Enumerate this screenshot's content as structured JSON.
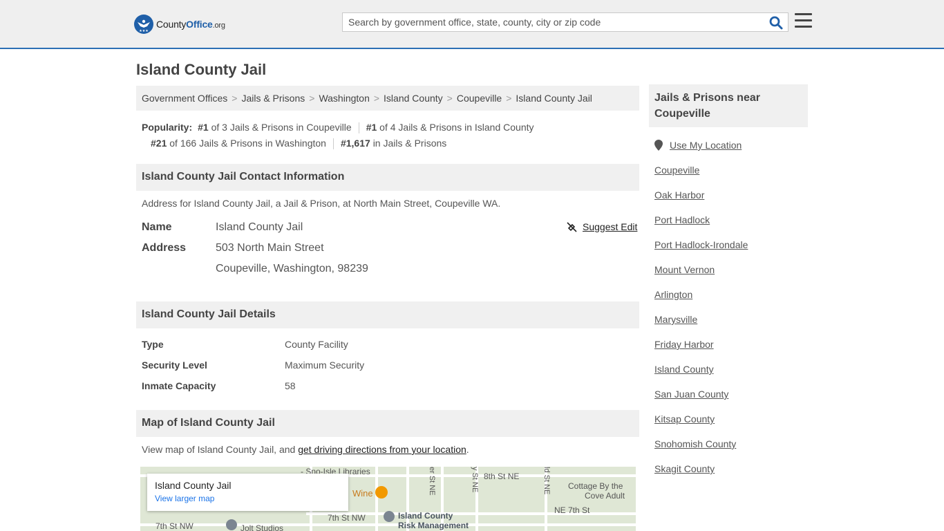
{
  "header": {
    "logo_county": "County",
    "logo_office": "Office",
    "logo_tld": ".org",
    "search_placeholder": "Search by government office, state, county, city or zip code"
  },
  "page": {
    "title": "Island County Jail"
  },
  "breadcrumb": [
    "Government Offices",
    "Jails & Prisons",
    "Washington",
    "Island County",
    "Coupeville",
    "Island County Jail"
  ],
  "popularity": {
    "label": "Popularity:",
    "items": [
      {
        "rank": "#1",
        "text": "of 3 Jails & Prisons in Coupeville"
      },
      {
        "rank": "#1",
        "text": "of 4 Jails & Prisons in Island County"
      },
      {
        "rank": "#21",
        "text": "of 166 Jails & Prisons in Washington"
      },
      {
        "rank": "#1,617",
        "text": "in Jails & Prisons"
      }
    ]
  },
  "contact": {
    "heading": "Island County Jail Contact Information",
    "description": "Address for Island County Jail, a Jail & Prison, at North Main Street, Coupeville WA.",
    "name_label": "Name",
    "name_value": "Island County Jail",
    "address_label": "Address",
    "address_line1": "503 North Main Street",
    "address_line2": "Coupeville, Washington, 98239",
    "suggest_edit": "Suggest Edit"
  },
  "details": {
    "heading": "Island County Jail Details",
    "rows": [
      {
        "label": "Type",
        "value": "County Facility"
      },
      {
        "label": "Security Level",
        "value": "Maximum Security"
      },
      {
        "label": "Inmate Capacity",
        "value": "58"
      }
    ]
  },
  "map_section": {
    "heading": "Map of Island County Jail",
    "description_prefix": "View map of Island County Jail, and ",
    "directions_link": "get driving directions from your location",
    "description_suffix": ".",
    "card_title": "Island County Jail",
    "card_link": "View larger map",
    "labels": {
      "libraries": "- Sno-Isle Libraries",
      "wine": "Wine",
      "eighth_st": "8th St NE",
      "cottage1": "Cottage By the",
      "cottage2": "Cove Adult",
      "seventh_nw": "7th St NW",
      "risk1": "Island County",
      "risk2": "Risk Management",
      "ne_seventh": "NE 7th St",
      "seventh_nw2": "7th St NW",
      "jolt": "Jolt Studios",
      "st_ne1": "er St NE",
      "st_ne2": "y St NE",
      "st_ne3": "ld St NE"
    }
  },
  "sidebar": {
    "heading": "Jails & Prisons near Coupeville",
    "use_location": "Use My Location",
    "links": [
      "Coupeville",
      "Oak Harbor",
      "Port Hadlock",
      "Port Hadlock-Irondale",
      "Mount Vernon",
      "Arlington",
      "Marysville",
      "Friday Harbor",
      "Island County",
      "San Juan County",
      "Kitsap County",
      "Snohomish County",
      "Skagit County"
    ]
  },
  "colors": {
    "brand_blue": "#1f5fa8",
    "header_bg": "#efefef",
    "section_bg": "#f0f0f0"
  }
}
